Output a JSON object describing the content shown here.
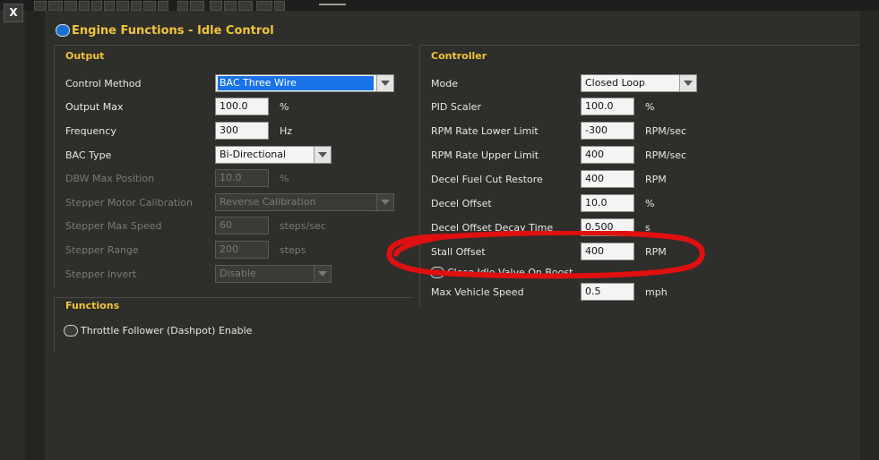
{
  "window": {
    "close_label": "X"
  },
  "panel": {
    "title": "Engine Functions - Idle Control"
  },
  "output": {
    "title": "Output",
    "rows": [
      {
        "label": "Control Method",
        "value": "BAC Three Wire",
        "type": "combo",
        "highlight": true
      },
      {
        "label": "Output Max",
        "value": "100.0",
        "unit": "%",
        "type": "field"
      },
      {
        "label": "Frequency",
        "value": "300",
        "unit": "Hz",
        "type": "field"
      },
      {
        "label": "BAC Type",
        "value": "Bi-Directional",
        "type": "combo"
      },
      {
        "label": "DBW Max Position",
        "value": "10.0",
        "unit": "%",
        "type": "field",
        "disabled": true
      },
      {
        "label": "Stepper Motor Calibration",
        "value": "Reverse Calibration",
        "type": "combo",
        "disabled": true
      },
      {
        "label": "Stepper Max Speed",
        "value": "60",
        "unit": "steps/sec",
        "type": "field",
        "disabled": true
      },
      {
        "label": "Stepper Range",
        "value": "200",
        "unit": "steps",
        "type": "field",
        "disabled": true
      },
      {
        "label": "Stepper Invert",
        "value": "Disable",
        "type": "combo",
        "disabled": true
      }
    ]
  },
  "functions": {
    "title": "Functions",
    "throttle_follower_label": "Throttle Follower (Dashpot) Enable"
  },
  "controller": {
    "title": "Controller",
    "rows": [
      {
        "label": "Mode",
        "value": "Closed Loop",
        "type": "combo"
      },
      {
        "label": "PID Scaler",
        "value": "100.0",
        "unit": "%",
        "type": "field"
      },
      {
        "label": "RPM Rate Lower Limit",
        "value": "-300",
        "unit": "RPM/sec",
        "type": "field"
      },
      {
        "label": "RPM Rate Upper Limit",
        "value": "400",
        "unit": "RPM/sec",
        "type": "field"
      },
      {
        "label": "Decel Fuel Cut Restore",
        "value": "400",
        "unit": "RPM",
        "type": "field"
      },
      {
        "label": "Decel Offset",
        "value": "10.0",
        "unit": "%",
        "type": "field"
      },
      {
        "label": "Decel Offset Decay Time",
        "value": "0.500",
        "unit": "s",
        "type": "field"
      },
      {
        "label": "Stall Offset",
        "value": "400",
        "unit": "RPM",
        "type": "field"
      }
    ],
    "close_idle_valve_label": "Close Idle Valve On Boost",
    "max_vehicle_speed": {
      "label": "Max Vehicle Speed",
      "value": "0.5",
      "unit": "mph"
    }
  },
  "colors": {
    "accent": "#f0c43a",
    "selection": "#1a73e8",
    "annotation": "#e01010"
  }
}
